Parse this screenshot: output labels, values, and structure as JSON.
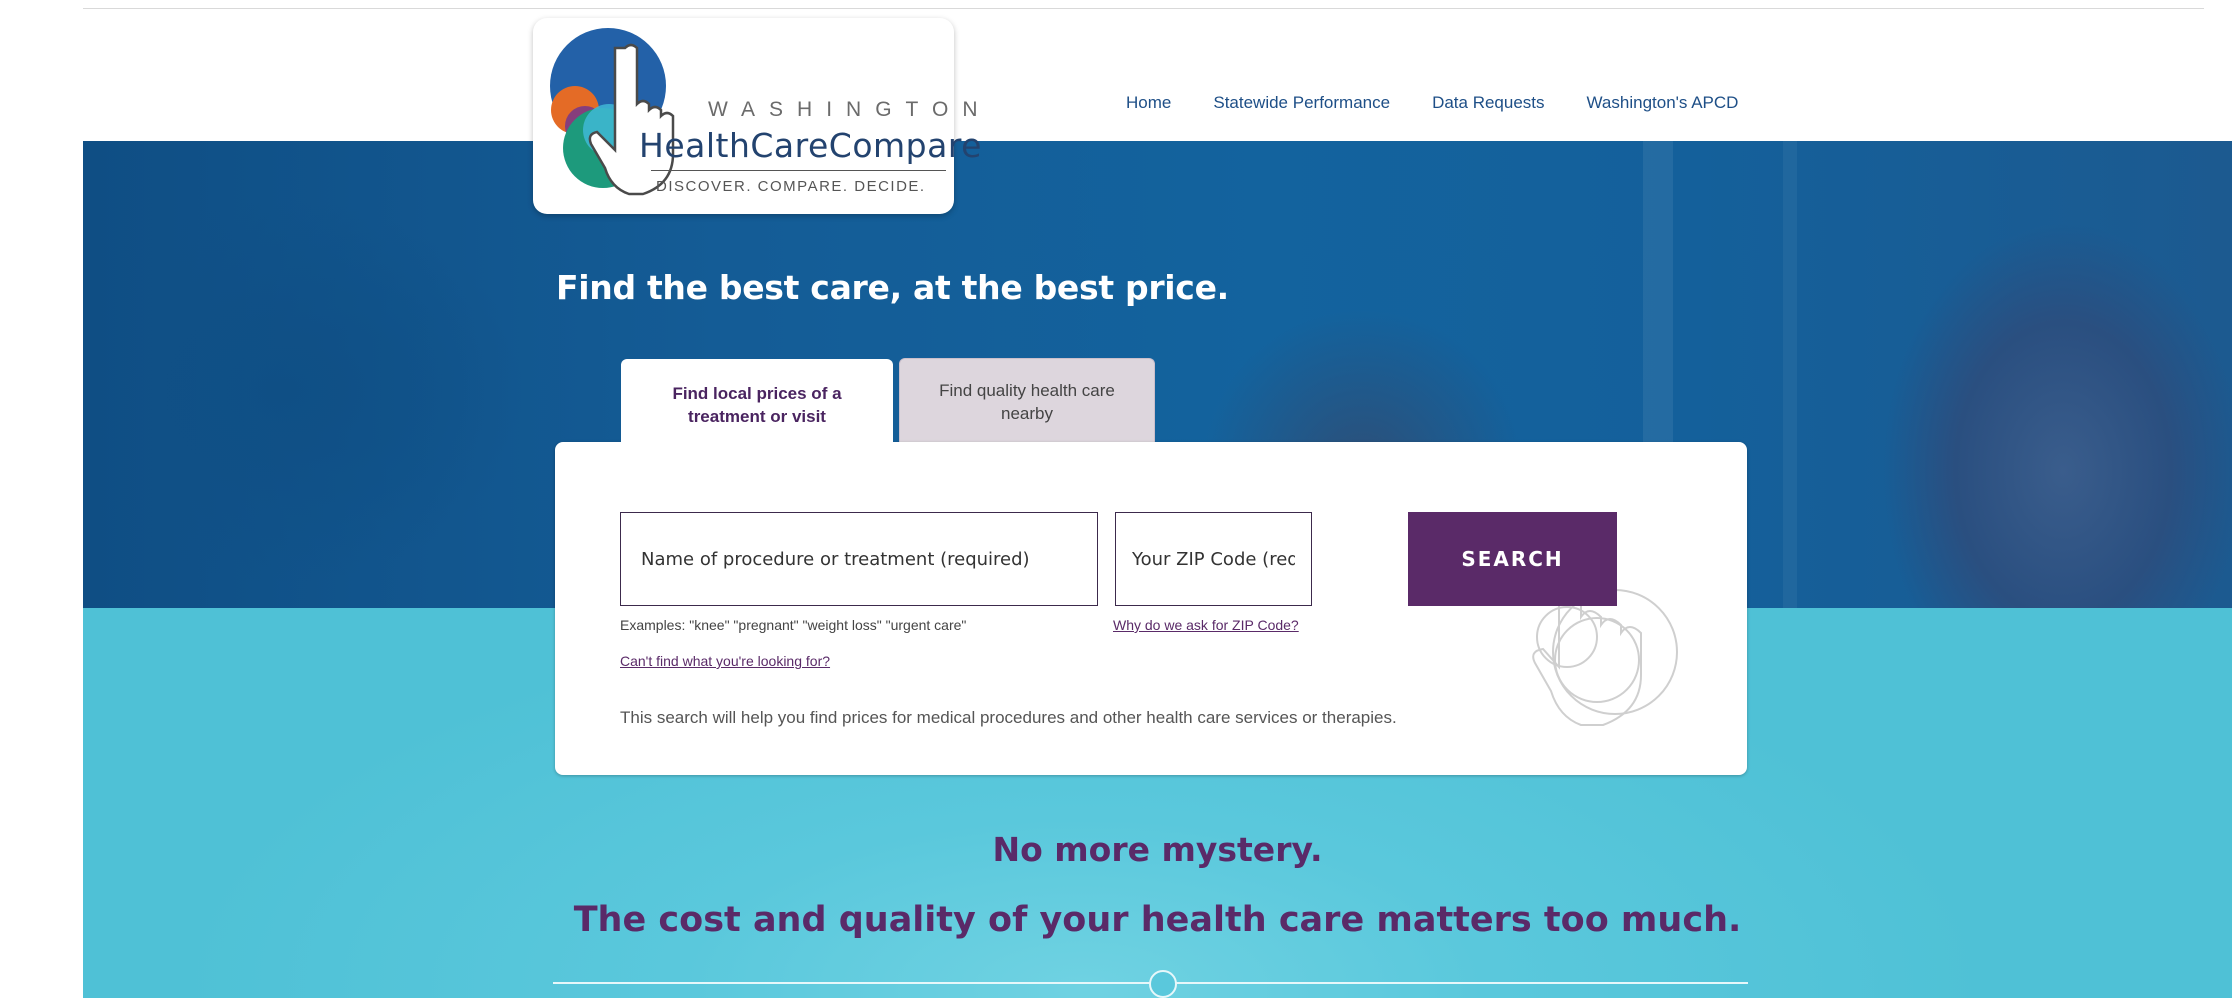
{
  "brand": {
    "state": "WASHINGTON",
    "name": "HealthCareCompare",
    "tagline": "DISCOVER. COMPARE. DECIDE."
  },
  "nav": {
    "items": [
      {
        "label": "Home"
      },
      {
        "label": "Statewide Performance"
      },
      {
        "label": "Data Requests"
      },
      {
        "label": "Washington's APCD"
      }
    ]
  },
  "hero": {
    "headline": "Find the best care, at the best price."
  },
  "tabs": [
    {
      "label": "Find local prices of a treatment or visit",
      "active": true
    },
    {
      "label": "Find quality health care nearby",
      "active": false
    }
  ],
  "search": {
    "procedure_placeholder": "Name of procedure or treatment (required)",
    "zip_placeholder": "Your ZIP Code (required)",
    "button_label": "SEARCH",
    "examples": "Examples: \"knee\" \"pregnant\" \"weight loss\" \"urgent care\"",
    "why_zip_link": "Why do we ask for ZIP Code?",
    "cant_find_link": "Can't find what you're looking for?",
    "helper_text": "This search will help you find prices for medical procedures and other health care services or therapies."
  },
  "taglines": {
    "line1": "No more mystery.",
    "line2": "The cost and quality of your health care matters too much."
  },
  "colors": {
    "brand_purple": "#5a2a68",
    "nav_blue": "#1e4f87",
    "hero_blue": "#145c96",
    "band_teal": "#5ac8dc"
  },
  "icons": [
    "logo-hand-icon",
    "hand-pointer-icon"
  ]
}
